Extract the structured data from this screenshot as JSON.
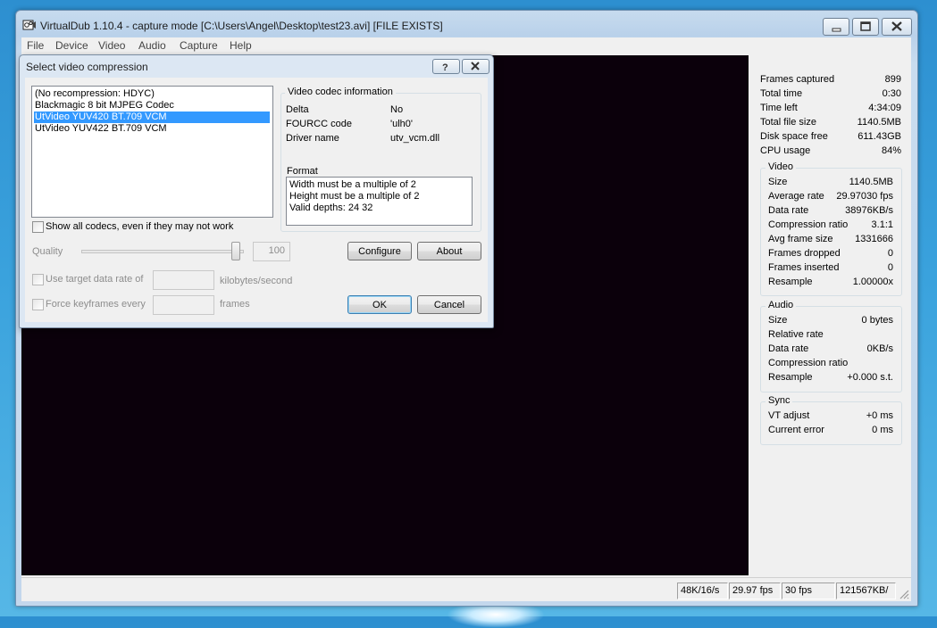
{
  "window": {
    "title": "VirtualDub 1.10.4 - capture mode [C:\\Users\\Angel\\Desktop\\test23.avi] [FILE EXISTS]",
    "menu": [
      "File",
      "Device",
      "Video",
      "Audio",
      "Capture",
      "Help"
    ],
    "icons": {
      "app": "virtualdub-icon",
      "minimize": "minimize-icon",
      "maximize": "maximize-icon",
      "close": "close-icon"
    }
  },
  "stats": {
    "top": [
      {
        "label": "Frames captured",
        "value": "899"
      },
      {
        "label": "Total time",
        "value": "0:30"
      },
      {
        "label": "Time left",
        "value": "4:34:09"
      },
      {
        "label": "Total file size",
        "value": "1140.5MB"
      },
      {
        "label": "Disk space free",
        "value": "611.43GB"
      },
      {
        "label": "CPU usage",
        "value": "84%"
      }
    ],
    "video": {
      "title": "Video",
      "rows": [
        {
          "label": "Size",
          "value": "1140.5MB"
        },
        {
          "label": "Average rate",
          "value": "29.97030 fps"
        },
        {
          "label": "Data rate",
          "value": "38976KB/s"
        },
        {
          "label": "Compression ratio",
          "value": "3.1:1"
        },
        {
          "label": "Avg frame size",
          "value": "1331666"
        },
        {
          "label": "Frames dropped",
          "value": "0"
        },
        {
          "label": "Frames inserted",
          "value": "0"
        },
        {
          "label": "Resample",
          "value": "1.00000x"
        }
      ]
    },
    "audio": {
      "title": "Audio",
      "rows": [
        {
          "label": "Size",
          "value": "0 bytes"
        },
        {
          "label": "Relative rate",
          "value": ""
        },
        {
          "label": "Data rate",
          "value": "0KB/s"
        },
        {
          "label": "Compression ratio",
          "value": ""
        },
        {
          "label": "Resample",
          "value": "+0.000 s.t."
        }
      ]
    },
    "sync": {
      "title": "Sync",
      "rows": [
        {
          "label": "VT adjust",
          "value": "+0 ms"
        },
        {
          "label": "Current error",
          "value": "0 ms"
        }
      ]
    }
  },
  "statusbar": [
    "48K/16/s",
    "29.97 fps",
    "30 fps",
    "121567KB/"
  ],
  "dialog": {
    "title": "Select video compression",
    "codecs": [
      "(No recompression: HDYC)",
      "Blackmagic 8 bit MJPEG Codec",
      "UtVideo YUV420 BT.709 VCM",
      "UtVideo YUV422 BT.709 VCM"
    ],
    "selected_codec": "UtVideo YUV420 BT.709 VCM",
    "show_all_label": "Show all codecs, even if they may not work",
    "codec_info": {
      "title": "Video codec information",
      "rows": [
        {
          "label": "Delta",
          "value": "No"
        },
        {
          "label": "FOURCC code",
          "value": "'ulh0'"
        },
        {
          "label": "Driver name",
          "value": "utv_vcm.dll"
        }
      ],
      "format_label": "Format",
      "format_lines": [
        "Width must be a multiple of 2",
        "Height must be a multiple of 2",
        "Valid depths: 24 32"
      ]
    },
    "quality_label": "Quality",
    "quality_value": "100",
    "configure_label": "Configure",
    "about_label": "About",
    "target_rate_label": "Use target data rate of",
    "target_rate_unit": "kilobytes/second",
    "keyframes_label": "Force keyframes every",
    "keyframes_unit": "frames",
    "ok_label": "OK",
    "cancel_label": "Cancel",
    "help_icon": "help-icon",
    "close_icon": "close-icon"
  }
}
